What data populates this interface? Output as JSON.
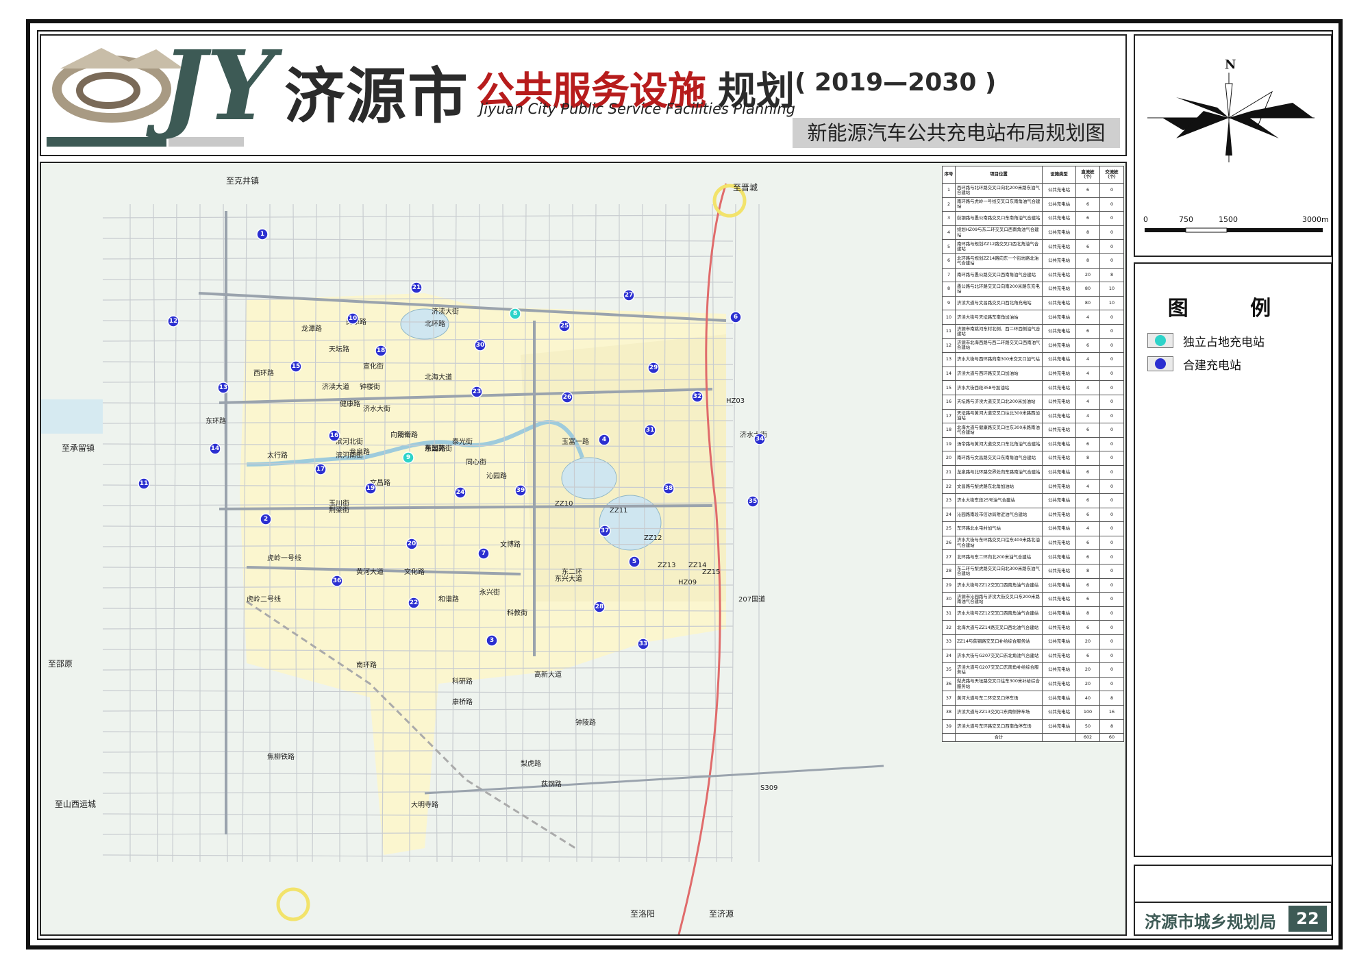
{
  "header": {
    "logo_text": "JY",
    "city": "济源市",
    "title_red": "公共服务设施",
    "title_black": "规划",
    "years": "( 2019—2030 )",
    "title_en": "Jiyuan City Public Service Facilities Planning",
    "subtitle": "新能源汽车公共充电站布局规划图"
  },
  "compass": {
    "north": "N",
    "scale_labels": [
      "0",
      "750",
      "1500",
      "3000m"
    ]
  },
  "legend": {
    "title": "图 例",
    "items": [
      {
        "label": "独立占地充电站",
        "color": "#2ed3c9"
      },
      {
        "label": "合建充电站",
        "color": "#2b2fd0"
      }
    ]
  },
  "footer": {
    "agency": "济源市城乡规划局",
    "page": "22"
  },
  "table": {
    "headers": [
      "序号",
      "项目位置",
      "设施类型",
      "直流桩（个）",
      "交流桩（个）"
    ],
    "rows": [
      [
        "1",
        "西环路与北环路交叉口向北200米路东油气合建站",
        "公共充电站",
        "6",
        "0"
      ],
      [
        "2",
        "南环路与虎岭一号线交叉口东南角油气合建站",
        "公共充电站",
        "6",
        "0"
      ],
      [
        "3",
        "荻钢路与愚公南路交叉口东南角油气合建站",
        "公共充电站",
        "6",
        "0"
      ],
      [
        "4",
        "规划HZ09与东二环交叉口西南角油气合建站",
        "公共充电站",
        "8",
        "0"
      ],
      [
        "5",
        "南环路与规划ZZ12路交叉口西北角油气合建站",
        "公共充电站",
        "6",
        "0"
      ],
      [
        "6",
        "北环路与规划ZZ14路向东一个街坊路北油气合建站",
        "公共充电站",
        "8",
        "0"
      ],
      [
        "7",
        "南环路与愚公路交叉口西南角油气合建站",
        "公共充电站",
        "20",
        "8"
      ],
      [
        "8",
        "愚公路与北环路交叉口向南200米路东充电站",
        "公共充电站",
        "80",
        "10"
      ],
      [
        "9",
        "济渎大道与文昌路交叉口西北角充电站",
        "公共充电站",
        "80",
        "10"
      ],
      [
        "10",
        "济渎大街与天坛路东南角加油站",
        "公共充电站",
        "4",
        "0"
      ],
      [
        "11",
        "济源市南姚河东村北侧、西二环西侧油气合建站",
        "公共充电站",
        "6",
        "0"
      ],
      [
        "12",
        "济源市北海西路与西二环路交叉口西南油气合建站",
        "公共充电站",
        "6",
        "0"
      ],
      [
        "13",
        "济水大街与西环路向南300米交叉口加气站",
        "公共充电站",
        "4",
        "0"
      ],
      [
        "14",
        "济渎大道与西环路交叉口加油站",
        "公共充电站",
        "4",
        "0"
      ],
      [
        "15",
        "济水大街西段358号加油站",
        "公共充电站",
        "4",
        "0"
      ],
      [
        "16",
        "天坛路与济渎大道交叉口北200米加油站",
        "公共充电站",
        "4",
        "0"
      ],
      [
        "17",
        "天坛路与黄河大道交叉口往北300米路西加油站",
        "公共充电站",
        "4",
        "0"
      ],
      [
        "18",
        "北海大道与健康路交叉口往东300米路南油气合建站",
        "公共充电站",
        "6",
        "0"
      ],
      [
        "19",
        "汤帝路与黄河大道交叉口东北角油气合建站",
        "公共充电站",
        "6",
        "0"
      ],
      [
        "20",
        "南环路与文昌路交叉口东南角油气合建站",
        "公共充电站",
        "8",
        "0"
      ],
      [
        "21",
        "龙泉路与北环路交界处向东路南油气合建站",
        "公共充电站",
        "6",
        "0"
      ],
      [
        "22",
        "文昌路与梨虎路东北角加油站",
        "公共充电站",
        "4",
        "0"
      ],
      [
        "23",
        "济水大街东段25号油气合建站",
        "公共充电站",
        "6",
        "0"
      ],
      [
        "24",
        "沁园路南段市信访局附近油气合建站",
        "公共充电站",
        "6",
        "0"
      ],
      [
        "25",
        "东环路北水屯村加气站",
        "公共充电站",
        "4",
        "0"
      ],
      [
        "26",
        "济水大街与东环路交叉口往东400米路北油气合建站",
        "公共充电站",
        "6",
        "0"
      ],
      [
        "27",
        "北环路与东二环向北200米油气合建站",
        "公共充电站",
        "6",
        "0"
      ],
      [
        "28",
        "东二环与梨虎路交叉口向北300米路东油气合建站",
        "公共充电站",
        "8",
        "0"
      ],
      [
        "29",
        "济水大街与ZZ12交叉口西南角油气合建站",
        "公共充电站",
        "6",
        "0"
      ],
      [
        "30",
        "济源市沁园路与济渎大街交叉口东200米路南油气合建站",
        "公共充电站",
        "6",
        "0"
      ],
      [
        "31",
        "济水大街与ZZ12交叉口西南角油气合建站",
        "公共充电站",
        "8",
        "0"
      ],
      [
        "32",
        "北海大道与ZZ14路交叉口西北油气合建站",
        "公共充电站",
        "6",
        "0"
      ],
      [
        "33",
        "ZZ14与荻钢路交叉口补给综合服务站",
        "公共充电站",
        "20",
        "0"
      ],
      [
        "34",
        "济水大街与G207交叉口东北角油气合建站",
        "公共充电站",
        "6",
        "0"
      ],
      [
        "35",
        "济渎大道与G207交叉口东南角补给综合服务站",
        "公共充电站",
        "20",
        "0"
      ],
      [
        "36",
        "梨虎路与天坛路交叉口往东300米补给综合服务站",
        "公共充电站",
        "20",
        "0"
      ],
      [
        "37",
        "黄河大道与东二环交叉口停车场",
        "公共充电站",
        "40",
        "8"
      ],
      [
        "38",
        "济渎大道与ZZ13交叉口东南侧停车场",
        "公共充电站",
        "100",
        "16"
      ],
      [
        "39",
        "济渎大道与东环路交叉口西南角停车场",
        "公共充电站",
        "50",
        "8"
      ]
    ],
    "total_label": "合计",
    "total_dc": "602",
    "total_ac": "60"
  },
  "map": {
    "roads": [
      "北环路",
      "济渎大街",
      "北海大道",
      "济水大街",
      "济渎大道",
      "黄河大道",
      "南环路",
      "东环路",
      "西环路",
      "太行路",
      "龙潭路",
      "天坛路",
      "民康路",
      "龙泉路",
      "健康路",
      "宣化街",
      "钟楼街",
      "滨河北街",
      "滨河南街",
      "玉川街",
      "愚公路",
      "文昌路",
      "汤帝路",
      "荆梁街",
      "沁园路",
      "文博路",
      "永兴街",
      "科教街",
      "科研路",
      "康桥路",
      "高新大道",
      "荻钢路",
      "梨虎路",
      "文化路",
      "和谐路",
      "大明寺路",
      "东兴大道",
      "玉富一路",
      "钟陵路",
      "HZ03",
      "HZ09",
      "ZZ10",
      "ZZ11",
      "ZZ12",
      "ZZ13",
      "ZZ14",
      "ZZ15",
      "S309",
      "207国道",
      "焦柳铁路",
      "东二环",
      "虎岭一号线",
      "虎岭二号线",
      "东园路",
      "向阳街",
      "河苑街",
      "泰光街",
      "同心街",
      "济水大街"
    ],
    "places": [
      "至克井镇",
      "至承留镇",
      "至邵原",
      "至山西运城",
      "至晋城",
      "至济源",
      "至洛阳"
    ],
    "stations": [
      {
        "id": "1",
        "type": "合建"
      },
      {
        "id": "2",
        "type": "合建"
      },
      {
        "id": "3",
        "type": "合建"
      },
      {
        "id": "4",
        "type": "合建"
      },
      {
        "id": "5",
        "type": "合建"
      },
      {
        "id": "6",
        "type": "合建"
      },
      {
        "id": "7",
        "type": "合建"
      },
      {
        "id": "8",
        "type": "独立"
      },
      {
        "id": "9",
        "type": "独立"
      },
      {
        "id": "10",
        "type": "合建"
      },
      {
        "id": "11",
        "type": "合建"
      },
      {
        "id": "12",
        "type": "合建"
      },
      {
        "id": "13",
        "type": "合建"
      },
      {
        "id": "14",
        "type": "合建"
      },
      {
        "id": "15",
        "type": "合建"
      },
      {
        "id": "16",
        "type": "合建"
      },
      {
        "id": "17",
        "type": "合建"
      },
      {
        "id": "18",
        "type": "合建"
      },
      {
        "id": "19",
        "type": "合建"
      },
      {
        "id": "20",
        "type": "合建"
      },
      {
        "id": "21",
        "type": "合建"
      },
      {
        "id": "22",
        "type": "合建"
      },
      {
        "id": "23",
        "type": "合建"
      },
      {
        "id": "24",
        "type": "合建"
      },
      {
        "id": "25",
        "type": "合建"
      },
      {
        "id": "26",
        "type": "合建"
      },
      {
        "id": "27",
        "type": "合建"
      },
      {
        "id": "28",
        "type": "合建"
      },
      {
        "id": "29",
        "type": "合建"
      },
      {
        "id": "30",
        "type": "合建"
      },
      {
        "id": "31",
        "type": "合建"
      },
      {
        "id": "32",
        "type": "合建"
      },
      {
        "id": "33",
        "type": "合建"
      },
      {
        "id": "34",
        "type": "合建"
      },
      {
        "id": "35",
        "type": "合建"
      },
      {
        "id": "36",
        "type": "合建"
      },
      {
        "id": "37",
        "type": "合建"
      },
      {
        "id": "38",
        "type": "合建"
      },
      {
        "id": "39",
        "type": "合建"
      }
    ]
  }
}
